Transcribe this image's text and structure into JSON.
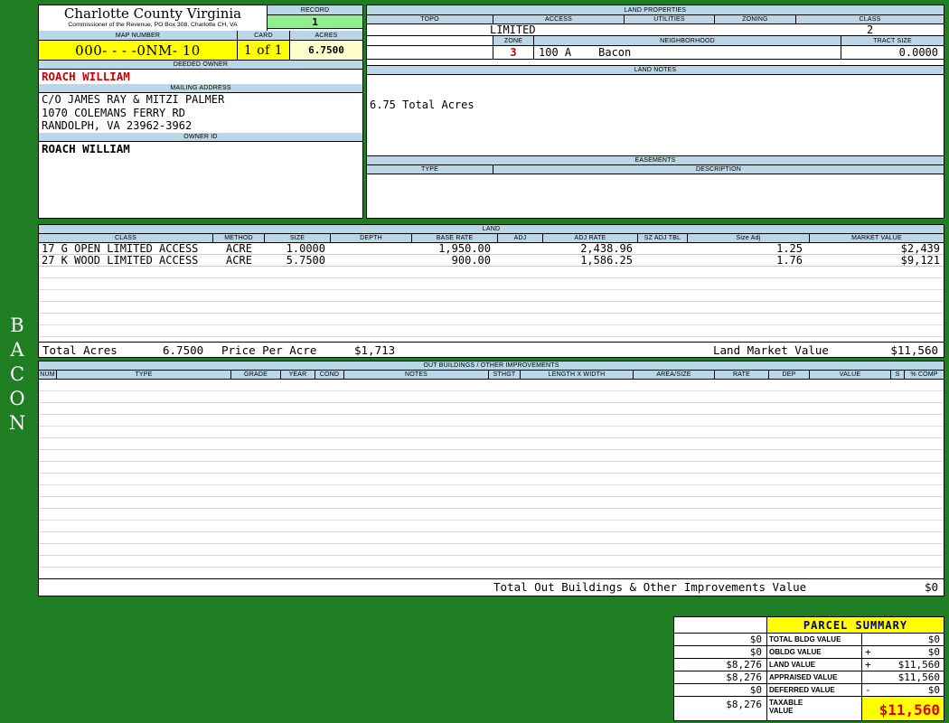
{
  "colors": {
    "bg-green": "#1f7d22",
    "header-blue": "#b9d7e6",
    "highlight-yellow": "#ffff00",
    "pale-yellow": "#ffffcc",
    "record-green": "#90ee90",
    "owner-red": "#cc0000",
    "summary-navy": "#000080",
    "taxable-red": "#dd0000"
  },
  "sidebar_label": "BACON",
  "county": {
    "title": "Charlotte County Virginia",
    "subtitle": "Commissioner of the Revenue, PO Box 308, Charlotte CH, VA"
  },
  "record": {
    "label": "RECORD",
    "value": "1"
  },
  "map": {
    "map_number_label": "MAP NUMBER",
    "map_number": "000- - -  -0NM- 10",
    "card_label": "CARD",
    "card": "1 of 1",
    "acres_label": "ACRES",
    "acres": "6.7500"
  },
  "owner": {
    "deeded_owner_label": "DEEDED OWNER",
    "deeded_owner": "ROACH WILLIAM",
    "mailing_address_label": "MAILING ADDRESS",
    "address_lines": [
      "C/O JAMES RAY & MITZI PALMER",
      "1070 COLEMANS FERRY RD",
      "RANDOLPH, VA 23962-3962"
    ],
    "owner_id_label": "OWNER ID",
    "owner_id": "ROACH WILLIAM"
  },
  "land_properties": {
    "title": "LAND PROPERTIES",
    "topo_label": "TOPO",
    "access_label": "ACCESS",
    "access": "LIMITED",
    "utilities_label": "UTILITIES",
    "zoning_label": "ZONING",
    "class_label": "CLASS",
    "class": "2",
    "zone_label": "ZONE",
    "zone": "3",
    "zone_code": "100 A",
    "neighborhood_label": "NEIGHBORHOOD",
    "neighborhood": "Bacon",
    "tract_size_label": "TRACT SIZE",
    "tract_size": "0.0000"
  },
  "land_notes": {
    "title": "LAND NOTES",
    "note": "6.75 Total Acres"
  },
  "easements": {
    "title": "EASEMENTS",
    "type_label": "TYPE",
    "description_label": "DESCRIPTION"
  },
  "land_table": {
    "title": "LAND",
    "columns": [
      "CLASS",
      "METHOD",
      "SIZE",
      "DEPTH",
      "BASE RATE",
      "ADJ",
      "ADJ RATE",
      "SZ ADJ TBL",
      "Size Adj",
      "MARKET VALUE"
    ],
    "rows": [
      {
        "cells": [
          "17 G OPEN LIMITED ACCESS",
          "ACRE",
          "1.0000",
          "",
          "1,950.00",
          "",
          "2,438.96",
          "",
          "1.25",
          "$2,439"
        ]
      },
      {
        "cells": [
          "27 K WOOD LIMITED ACCESS",
          "ACRE",
          "5.7500",
          "",
          "900.00",
          "",
          "1,586.25",
          "",
          "1.76",
          "$9,121"
        ]
      }
    ],
    "totals": {
      "total_acres_label": "Total Acres",
      "total_acres": "6.7500",
      "price_per_acre_label": "Price Per Acre",
      "price_per_acre": "$1,713",
      "land_market_value_label": "Land Market Value",
      "land_market_value": "$11,560"
    }
  },
  "out_buildings": {
    "title": "OUT BUILDINGS / OTHER IMPROVEMENTS",
    "columns": [
      "NUM",
      "TYPE",
      "GRADE",
      "YEAR",
      "COND",
      "NOTES",
      "STHGT",
      "LENGTH X WIDTH",
      "AREA/SIZE",
      "RATE",
      "DEP",
      "VALUE",
      "S",
      "% COMP"
    ],
    "total_label": "Total Out Buildings & Other Improvements Value",
    "total_value": "$0"
  },
  "parcel_summary": {
    "title": "PARCEL SUMMARY",
    "rows": [
      {
        "prior": "$0",
        "label": "TOTAL BLDG VALUE",
        "op": "",
        "value": "$0"
      },
      {
        "prior": "$0",
        "label": "OBLDG VALUE",
        "op": "+",
        "value": "$0"
      },
      {
        "prior": "$8,276",
        "label": "LAND VALUE",
        "op": "+",
        "value": "$11,560"
      },
      {
        "prior": "$8,276",
        "label": "APPRAISED VALUE",
        "op": "",
        "value": "$11,560"
      },
      {
        "prior": "$0",
        "label": "DEFERRED VALUE",
        "op": "-",
        "value": "$0"
      },
      {
        "prior": "$8,276",
        "label": "TAXABLE VALUE",
        "op": "",
        "value": "$11,560"
      }
    ]
  }
}
